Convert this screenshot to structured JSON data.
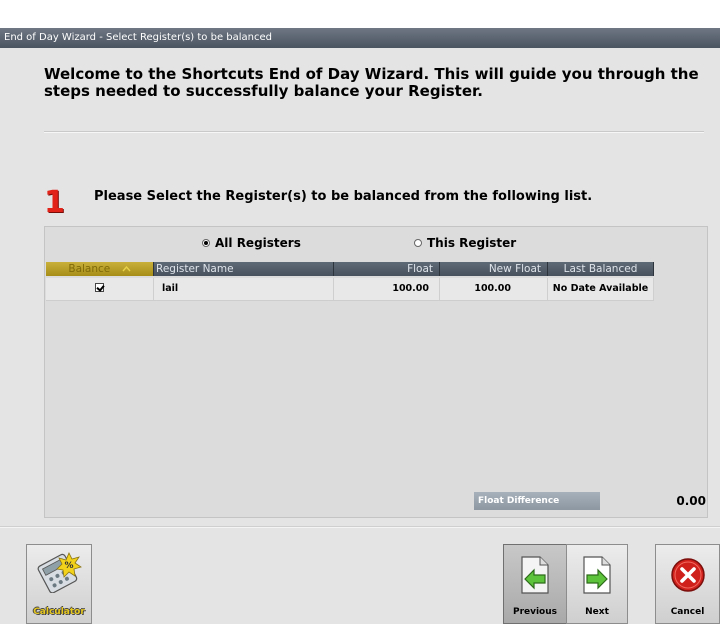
{
  "window": {
    "title": "End of Day Wizard - Select Register(s) to be balanced"
  },
  "welcome_text": "Welcome to the Shortcuts End of Day Wizard. This will guide you through the steps needed to successfully balance your Register.",
  "step": {
    "number": "1",
    "instruction": "Please Select the Register(s) to be balanced from the following list."
  },
  "filter": {
    "options": [
      {
        "label": "All Registers",
        "selected": true
      },
      {
        "label": "This Register",
        "selected": false
      }
    ]
  },
  "table": {
    "columns": [
      "Balance",
      "Register Name",
      "Float",
      "New Float",
      "Last Balanced"
    ],
    "sorted_column": "Balance",
    "rows": [
      {
        "balance": true,
        "register_name": "lail",
        "float": "100.00",
        "new_float": "100.00",
        "last_balanced": "No Date Available"
      }
    ]
  },
  "float_difference": {
    "label": "Float Difference",
    "value": "0.00"
  },
  "buttons": {
    "calculator": "Calculator",
    "previous": "Previous",
    "next": "Next",
    "cancel": "Cancel"
  },
  "colors": {
    "title_bar": "#4f5966",
    "step_number": "#e2231a",
    "sorted_header": "#b89e22",
    "cancel_red": "#d0201c"
  },
  "icons": {
    "calculator": "calculator-icon",
    "previous": "arrow-left-icon",
    "next": "arrow-right-icon",
    "cancel": "close-icon",
    "sort": "sort-up-icon"
  }
}
